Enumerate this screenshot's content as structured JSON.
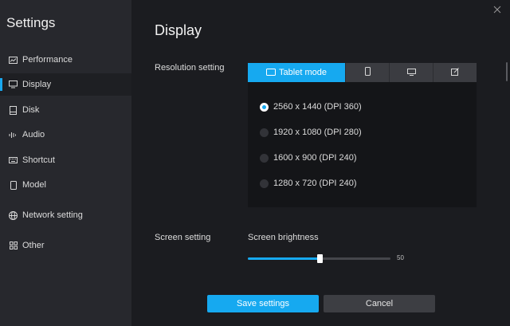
{
  "app_title": "Settings",
  "sidebar": {
    "items": [
      {
        "label": "Performance",
        "icon": "performance-icon",
        "active": false
      },
      {
        "label": "Display",
        "icon": "display-icon",
        "active": true
      },
      {
        "label": "Disk",
        "icon": "disk-icon",
        "active": false
      },
      {
        "label": "Audio",
        "icon": "audio-icon",
        "active": false
      },
      {
        "label": "Shortcut",
        "icon": "keyboard-icon",
        "active": false
      },
      {
        "label": "Model",
        "icon": "phone-icon",
        "active": false
      },
      {
        "label": "Network setting",
        "icon": "globe-icon",
        "active": false
      },
      {
        "label": "Other",
        "icon": "grid-icon",
        "active": false
      }
    ]
  },
  "page": {
    "title": "Display"
  },
  "resolution": {
    "label": "Resolution setting",
    "tabs": [
      {
        "label": "Tablet mode",
        "icon": "tablet-icon",
        "active": true
      },
      {
        "label": "",
        "icon": "phone-icon",
        "active": false
      },
      {
        "label": "",
        "icon": "monitor-icon",
        "active": false
      },
      {
        "label": "",
        "icon": "edit-icon",
        "active": false
      }
    ],
    "options": [
      {
        "label": "2560 x 1440 (DPI 360)",
        "selected": true
      },
      {
        "label": "1920 x 1080 (DPI 280)",
        "selected": false
      },
      {
        "label": "1600 x 900 (DPI 240)",
        "selected": false
      },
      {
        "label": "1280 x 720 (DPI 240)",
        "selected": false
      }
    ]
  },
  "screen": {
    "label": "Screen setting",
    "brightness_label": "Screen brightness",
    "brightness_value": "50",
    "brightness_fraction": 0.5
  },
  "buttons": {
    "save": "Save settings",
    "cancel": "Cancel"
  },
  "colors": {
    "accent": "#16a9f0",
    "sidebar_bg": "#27282d",
    "content_bg": "#1b1c20",
    "panel_bg": "#141518"
  }
}
